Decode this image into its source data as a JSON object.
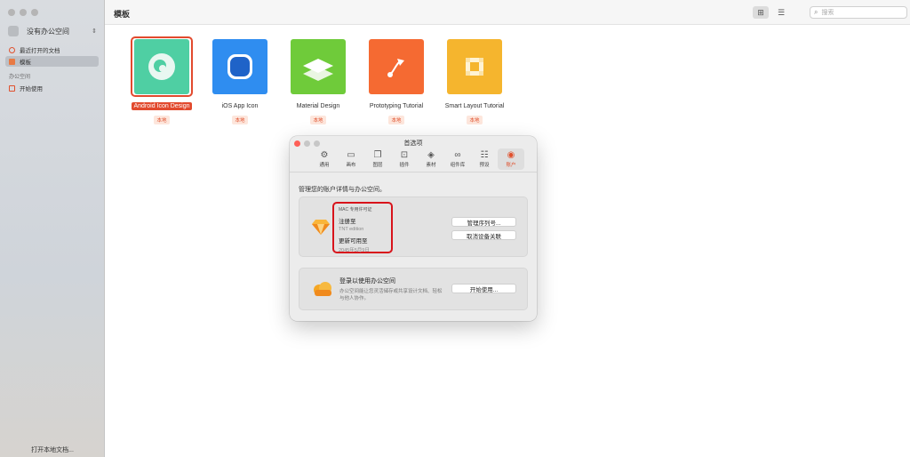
{
  "sidebar": {
    "workspace_switch": "没有办公空间",
    "items": [
      {
        "label": "最近打开的文档"
      },
      {
        "label": "模板"
      }
    ],
    "section_title": "办公空间",
    "workspace_items": [
      {
        "label": "开始使用"
      }
    ],
    "footer": "打开本地文档..."
  },
  "header": {
    "title": "模板",
    "search_placeholder": "搜索"
  },
  "templates": [
    {
      "name": "Android Icon Design",
      "badge": "本地",
      "color": "#4fcfa3"
    },
    {
      "name": "iOS App Icon",
      "badge": "本地",
      "color": "#2f8df0"
    },
    {
      "name": "Material Design",
      "badge": "本地",
      "color": "#6fcb3a"
    },
    {
      "name": "Prototyping Tutorial",
      "badge": "本地",
      "color": "#f56a32"
    },
    {
      "name": "Smart Layout Tutorial",
      "badge": "本地",
      "color": "#f5b52e"
    }
  ],
  "dialog": {
    "title": "首选项",
    "tabs": [
      {
        "label": "通用",
        "icon": "gear-icon"
      },
      {
        "label": "画布",
        "icon": "canvas-icon"
      },
      {
        "label": "图层",
        "icon": "layers-icon"
      },
      {
        "label": "插件",
        "icon": "plugin-icon"
      },
      {
        "label": "素材",
        "icon": "stack-icon"
      },
      {
        "label": "组件库",
        "icon": "link-icon"
      },
      {
        "label": "预设",
        "icon": "sliders-icon"
      },
      {
        "label": "账户",
        "icon": "account-icon"
      }
    ],
    "description": "管理您的账户详情与办公空间。",
    "license": {
      "type_label": "MAC 专用许可证",
      "registered_label": "注册至",
      "registered_value": "TNT edition",
      "updates_label": "更新可用至",
      "updates_value": "2045年5月9日",
      "manage_button": "管理序列号...",
      "unlink_button": "取消设备关联"
    },
    "workspace": {
      "title": "登录以使用办公空间",
      "description": "办公空间能让您灵活储存或共享设计文档、轻松与他人协作。",
      "start_button": "开始使用..."
    }
  },
  "colors": {
    "accent": "#e24a2e",
    "license_highlight": "#d8131b"
  }
}
